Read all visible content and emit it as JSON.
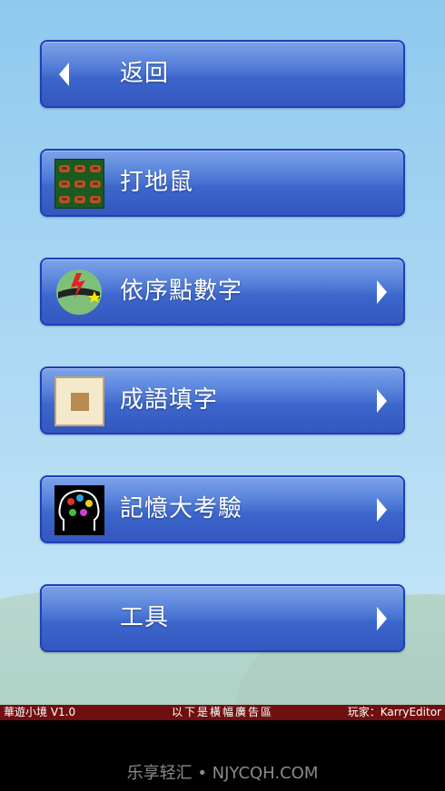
{
  "menu": [
    {
      "label": "返回",
      "icon": "back-arrow-icon"
    },
    {
      "label": "打地鼠",
      "icon": "whack-a-mole-thumbnail",
      "chevron": false
    },
    {
      "label": "依序點數字",
      "icon": "head-lightning-thumbnail",
      "chevron": true
    },
    {
      "label": "成語填字",
      "icon": "idiom-grid-thumbnail",
      "chevron": true
    },
    {
      "label": "記憶大考驗",
      "icon": "brain-head-thumbnail",
      "chevron": true
    },
    {
      "label": "工具",
      "chevron": true
    }
  ],
  "status_bar": {
    "app_version": "華遊小境 V1.0",
    "ad_notice": "以下是橫幅廣告區",
    "player": "玩家：KarryEditor",
    "color": "#700f10"
  },
  "watermark": "乐享轻汇 • NJYCQH.COM",
  "colors": {
    "button_top": "#5f8ee3",
    "button_bottom": "#3357c0",
    "button_border": "#1f3fb8",
    "sky_top": "#8fc9ef"
  }
}
